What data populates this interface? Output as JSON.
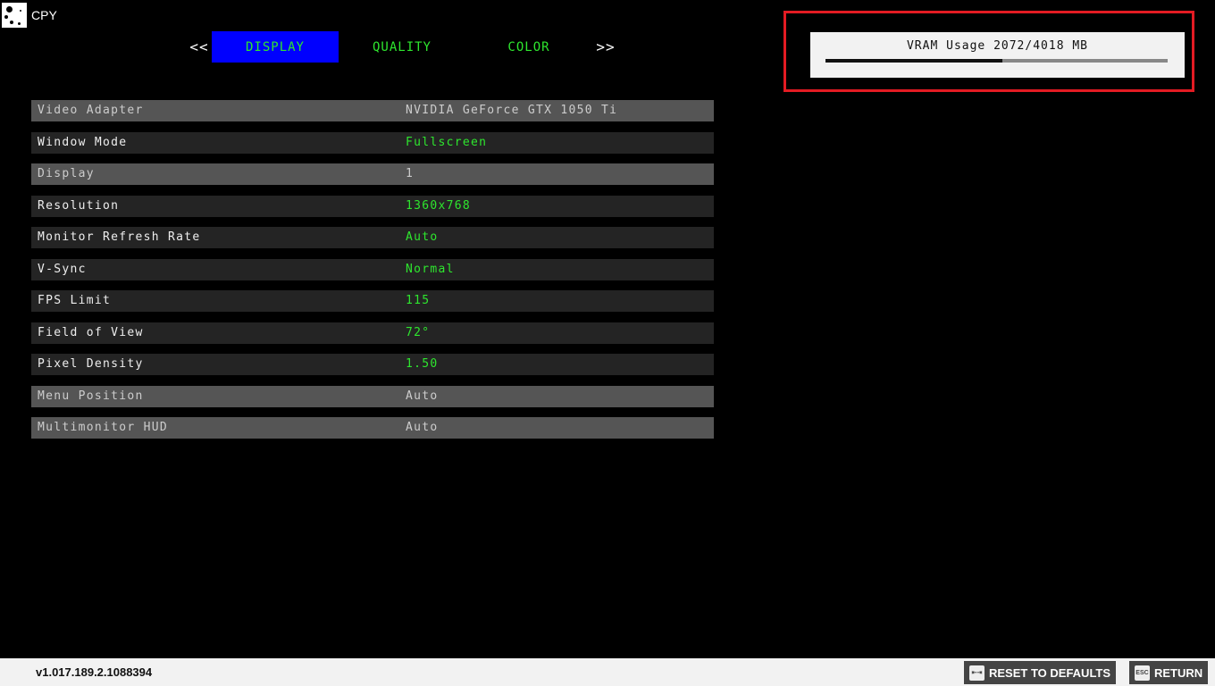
{
  "brand": "CPY",
  "nav": {
    "prev": "<<",
    "next": ">>",
    "tabs": [
      {
        "label": "DISPLAY",
        "active": true
      },
      {
        "label": "QUALITY"
      },
      {
        "label": "COLOR"
      }
    ]
  },
  "vram": {
    "label": "VRAM Usage 2072/4018 MB",
    "used": 2072,
    "total": 4018
  },
  "settings": [
    {
      "label": "Video Adapter",
      "value": "NVIDIA GeForce GTX 1050 Ti",
      "enabled": false
    },
    {
      "label": "Window Mode",
      "value": "Fullscreen",
      "enabled": true
    },
    {
      "label": "Display",
      "value": "1",
      "enabled": false
    },
    {
      "label": "Resolution",
      "value": "1360x768",
      "enabled": true
    },
    {
      "label": "Monitor Refresh Rate",
      "value": "Auto",
      "enabled": true
    },
    {
      "label": "V-Sync",
      "value": "Normal",
      "enabled": true
    },
    {
      "label": "FPS Limit",
      "value": "115",
      "enabled": true
    },
    {
      "label": "Field of View",
      "value": "72°",
      "enabled": true
    },
    {
      "label": "Pixel Density",
      "value": "1.50",
      "enabled": true
    },
    {
      "label": "Menu Position",
      "value": "Auto",
      "enabled": false
    },
    {
      "label": "Multimonitor HUD",
      "value": "Auto",
      "enabled": false
    }
  ],
  "footer": {
    "version": "v1.017.189.2.1088394",
    "reset": "RESET TO DEFAULTS",
    "return": "RETURN",
    "esc_key": "ESC"
  }
}
